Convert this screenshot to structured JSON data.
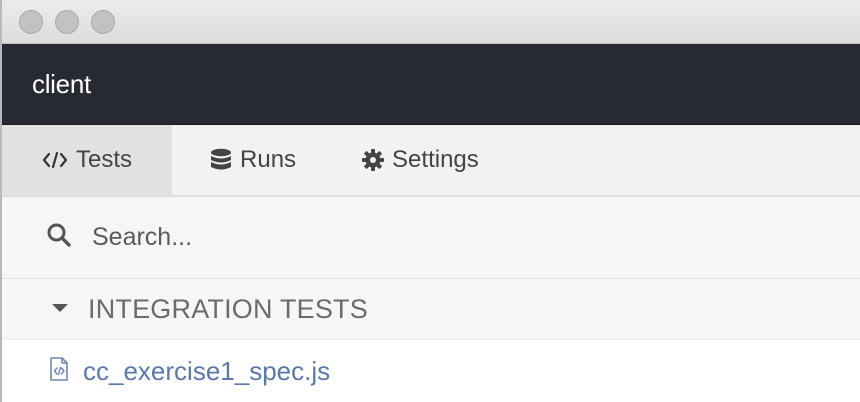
{
  "window": {
    "controls": [
      "close",
      "minimize",
      "maximize"
    ]
  },
  "appbar": {
    "title": "client"
  },
  "tabs": [
    {
      "icon": "code-icon",
      "label": "Tests",
      "active": true
    },
    {
      "icon": "database-icon",
      "label": "Runs",
      "active": false
    },
    {
      "icon": "gear-icon",
      "label": "Settings",
      "active": false
    }
  ],
  "search": {
    "placeholder": "Search...",
    "value": ""
  },
  "section": {
    "label": "INTEGRATION TESTS",
    "expanded": true
  },
  "files": [
    {
      "icon": "code-file-icon",
      "name": "cc_exercise1_spec.js"
    }
  ],
  "colors": {
    "appbar_bg": "#272a33",
    "link": "#5a78b0",
    "active_tab_bg": "#e2e2e2"
  }
}
